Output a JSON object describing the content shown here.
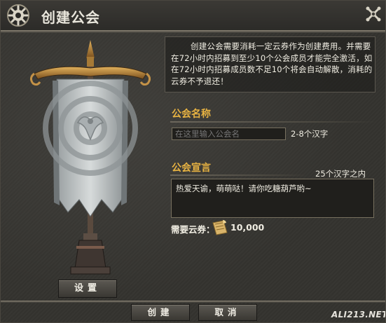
{
  "window": {
    "title": "创建公会"
  },
  "info": {
    "text": "创建公会需要消耗一定云券作为创建费用。并需要在72小时内招募到至少10个公会成员才能完全激活，如在72小时内招募成员数不足10个将会自动解散，消耗的云券不予退还！"
  },
  "guild_name": {
    "label": "公会名称",
    "placeholder": "在这里输入公会名",
    "hint": "2-8个汉字"
  },
  "declaration": {
    "label": "公会宣言",
    "limit": "25个汉字之内",
    "value": "热爱天谕，萌萌哒！请你吃糖葫芦哟~"
  },
  "cost": {
    "label": "需要云券：",
    "value": "10,000",
    "icon": "cloud-coupon-icon"
  },
  "buttons": {
    "setup": "设置",
    "create": "创建",
    "cancel": "取消"
  },
  "watermark": "ALI213.NET",
  "colors": {
    "accent": "#e8b342",
    "text": "#f0ede2",
    "panel": "#34332f"
  }
}
